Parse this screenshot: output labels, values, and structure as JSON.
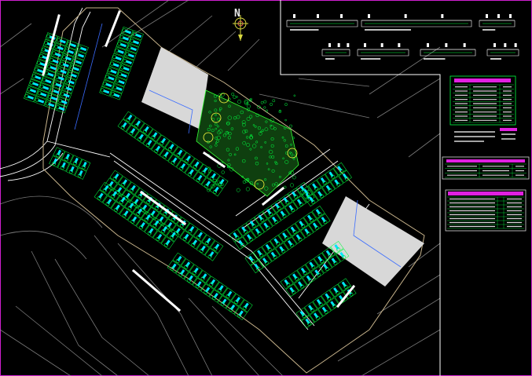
{
  "drawing": {
    "north_label": "N",
    "colors": {
      "background": "#000000",
      "frame": "#d020d0",
      "road_lines": "#ffffff",
      "site_boundary": "#c8b48c",
      "lot_outline": "#00ff40",
      "house_fill": "#00e5ff",
      "tree_symbol": "#00ff40",
      "hatch_area": "#d8d8d8",
      "legend_header": "#e020e0",
      "service_line": "#3a6cff"
    },
    "icons": [
      "north-arrow-icon",
      "tree-icon",
      "house-block-icon"
    ]
  }
}
